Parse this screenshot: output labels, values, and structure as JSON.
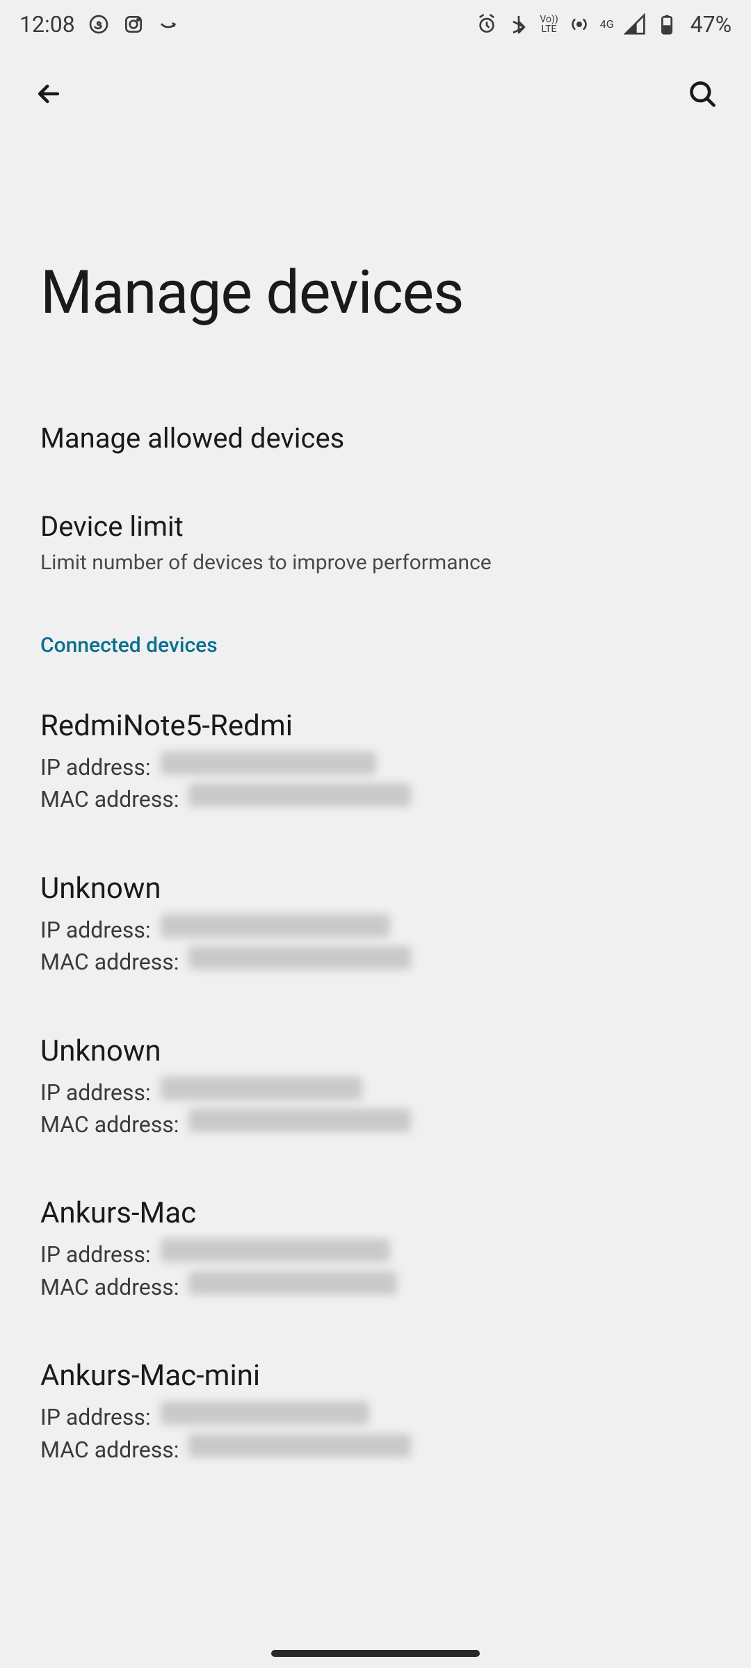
{
  "status": {
    "time": "12:08",
    "network_label": "4G",
    "volte_top": "Vo))",
    "volte_bottom": "LTE",
    "battery_text": "47%"
  },
  "header": {
    "title": "Manage devices"
  },
  "items": {
    "manage_allowed": {
      "title": "Manage allowed devices"
    },
    "device_limit": {
      "title": "Device limit",
      "subtitle": "Limit number of devices to improve performance"
    }
  },
  "section": {
    "connected": "Connected devices"
  },
  "labels": {
    "ip": "IP address: ",
    "mac": "MAC address: "
  },
  "devices": [
    {
      "name": "RedmiNote5-Redmi",
      "ip_w": 310,
      "mac_w": 320
    },
    {
      "name": "Unknown",
      "ip_w": 330,
      "mac_w": 320
    },
    {
      "name": "Unknown",
      "ip_w": 290,
      "mac_w": 320
    },
    {
      "name": "Ankurs-Mac",
      "ip_w": 330,
      "mac_w": 300
    },
    {
      "name": "Ankurs-Mac-mini",
      "ip_w": 300,
      "mac_w": 320
    }
  ]
}
